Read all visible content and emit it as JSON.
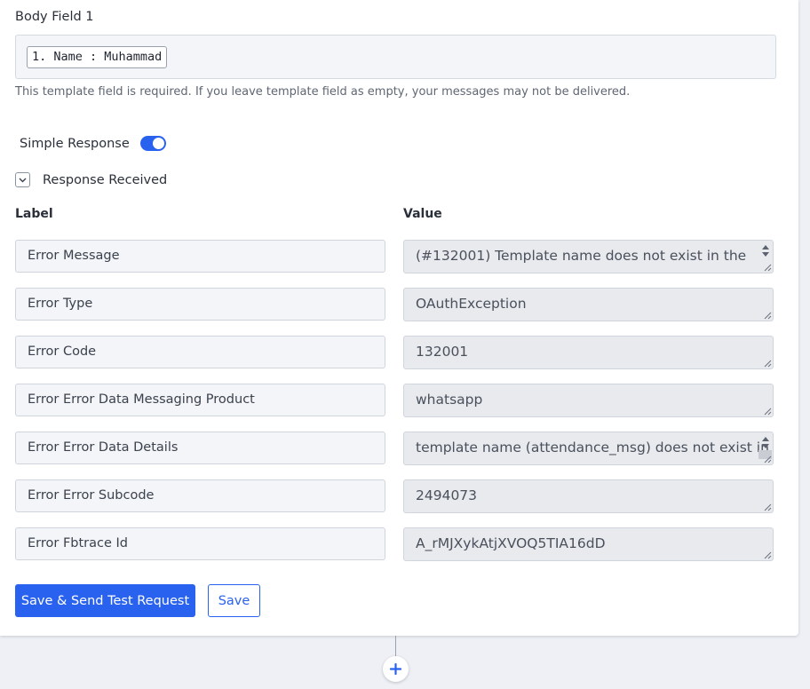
{
  "body_field": {
    "title": "Body Field 1",
    "chip": "1. Name : Muhammad",
    "helper": "This template field is required. If you leave template field as empty, your messages may not be delivered."
  },
  "simple_response": {
    "label": "Simple Response",
    "enabled": true
  },
  "response_received": {
    "label": "Response Received",
    "expanded": true
  },
  "columns": {
    "label": "Label",
    "value": "Value"
  },
  "rows": [
    {
      "label": "Error Message",
      "value": "(#132001) Template name does not exist in the"
    },
    {
      "label": "Error Type",
      "value": "OAuthException"
    },
    {
      "label": "Error Code",
      "value": "132001"
    },
    {
      "label": "Error Error Data Messaging Product",
      "value": "whatsapp"
    },
    {
      "label": "Error Error Data Details",
      "value": "template name (attendance_msg) does not exist in"
    },
    {
      "label": "Error Error Subcode",
      "value": "2494073"
    },
    {
      "label": "Error Fbtrace Id",
      "value": "A_rMJXykAtjXVOQ5TIA16dD"
    }
  ],
  "buttons": {
    "primary": "Save & Send Test Request",
    "secondary": "Save"
  },
  "colors": {
    "accent": "#2a62f0",
    "card": "#ffffff",
    "background": "#eef0f5"
  },
  "icons": {
    "toggle": "toggle-on-icon",
    "chevron": "chevron-down-icon",
    "add": "plus-icon"
  }
}
